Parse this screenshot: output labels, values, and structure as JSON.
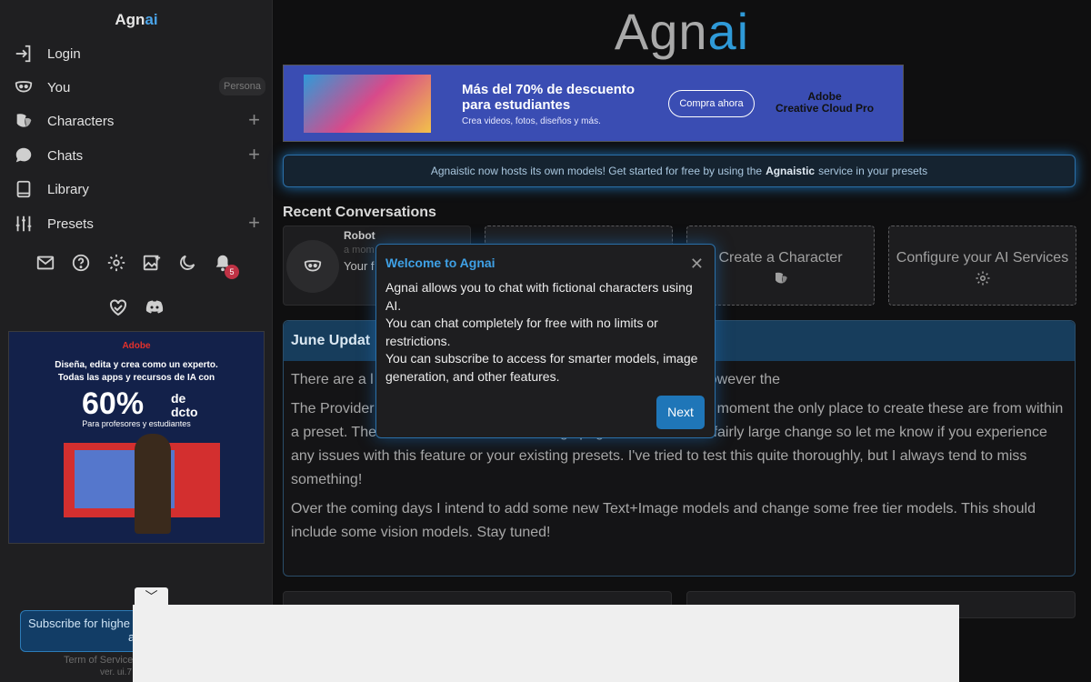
{
  "app": {
    "name_prefix": "Agn",
    "name_suffix": "ai"
  },
  "sidebar": {
    "items": [
      {
        "label": "Login",
        "icon": "login-icon"
      },
      {
        "label": "You",
        "icon": "mask-icon",
        "badge": "Persona"
      },
      {
        "label": "Characters",
        "icon": "characters-icon",
        "plus": "+"
      },
      {
        "label": "Chats",
        "icon": "chat-bubble-icon",
        "plus": "+"
      },
      {
        "label": "Library",
        "icon": "book-icon"
      },
      {
        "label": "Presets",
        "icon": "sliders-icon",
        "plus": "+"
      }
    ],
    "notification_count": "5",
    "subscribe_label": "Subscribe for highe",
    "subscribe_label2": "a",
    "footer_terms": "Term of Service",
    "footer_version": "ver. ui.7"
  },
  "side_ad": {
    "brand": "Adobe",
    "line1": "Diseña, edita y crea como un experto.",
    "line2": "Todas las apps y recursos de IA con",
    "percent": "60%",
    "de": "de",
    "dcto": "dcto",
    "sub": "Para profesores y estudiantes"
  },
  "top_ad": {
    "headline": "Más del 70% de descuento para estudiantes",
    "tagline": "Crea videos, fotos, diseños y más.",
    "cta": "Compra ahora",
    "brand_line1": "Adobe",
    "brand_line2": "Creative Cloud Pro"
  },
  "banner": {
    "prefix": "Agnaistic now hosts its own models! Get started for free by using the",
    "bold": "Agnaistic",
    "suffix": "service in your presets"
  },
  "recent": {
    "title": "Recent Conversations",
    "robot_name": "Robot",
    "robot_time": "a mom",
    "robot_msg": "Your f",
    "create_character": "Create a Character",
    "configure_ai": "Configure your AI Services"
  },
  "update": {
    "title": "June Updat",
    "p1": "There are a l                                                                                  A more comprehensive list is featured on Discord, however the",
    "p2": "The Provider                                                                                    sily create and switch between in your preset. At the moment the only place to create these are from within a preset. These will be added to the settings page soon. This is a fairly large change so let me know if you experience any issues with this feature or your existing presets. I've tried to test this quite thoroughly, but I always tend to miss something!",
    "p3": "Over the coming days I intend to add some new Text+Image models and change some free tier models. This should include some vision models. Stay tuned!"
  },
  "modal": {
    "title": "Welcome to Agnai",
    "line1": "Agnai allows you to chat with fictional characters using AI.",
    "line2": "You can chat completely for free with no limits or restrictions.",
    "line3": "You can subscribe to access for smarter models, image generation, and other features.",
    "next": "Next",
    "close": "✕"
  },
  "collapse": {
    "glyph": "﹀"
  },
  "colors": {
    "accent": "#2f9ad8",
    "badge": "#c03245",
    "modal_border": "#2a6fa8"
  }
}
